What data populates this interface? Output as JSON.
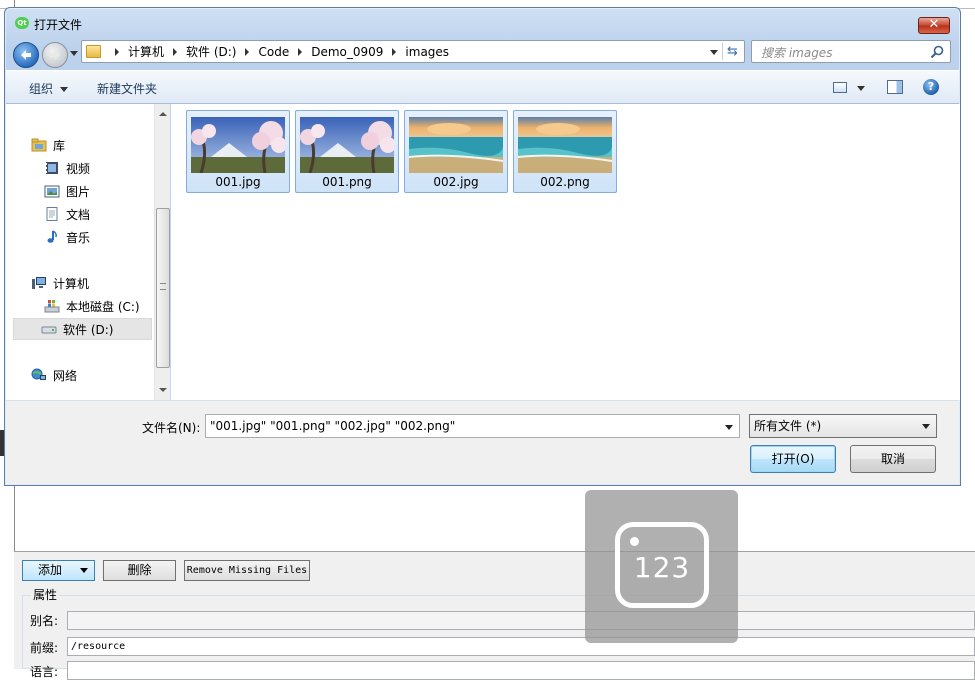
{
  "dialog": {
    "title": "打开文件",
    "app_icon_text": "Qt",
    "close_glyph": "✕"
  },
  "address": {
    "crumbs": [
      "计算机",
      "软件 (D:)",
      "Code",
      "Demo_0909",
      "images"
    ]
  },
  "search": {
    "placeholder": "搜索 images"
  },
  "toolbar": {
    "organize_label": "组织",
    "new_folder_label": "新建文件夹",
    "help_glyph": "?"
  },
  "nav": {
    "libraries": {
      "label": "库",
      "items": [
        "视频",
        "图片",
        "文档",
        "音乐"
      ]
    },
    "computer": {
      "label": "计算机",
      "items": [
        "本地磁盘 (C:)",
        "软件 (D:)"
      ]
    },
    "network": {
      "label": "网络"
    },
    "selected": "软件 (D:)"
  },
  "files": [
    {
      "name": "001.jpg",
      "thumb": "cherry-blossom"
    },
    {
      "name": "001.png",
      "thumb": "cherry-blossom"
    },
    {
      "name": "002.jpg",
      "thumb": "beach-sunset"
    },
    {
      "name": "002.png",
      "thumb": "beach-sunset"
    }
  ],
  "bottom": {
    "filename_label": "文件名(N):",
    "filename_value": "\"001.jpg\" \"001.png\" \"002.jpg\" \"002.png\"",
    "filetype_value": "所有文件 (*)",
    "open_label": "打开(O)",
    "cancel_label": "取消"
  },
  "background_app": {
    "add_label": "添加",
    "delete_label": "删除",
    "remove_missing_label": "Remove Missing Files",
    "properties_title": "属性",
    "alias_label": "别名:",
    "prefix_label": "前缀:",
    "prefix_value": "/resource",
    "lang_label": "语言:"
  },
  "watermark": {
    "text": "123"
  },
  "colors": {
    "selection_bg": "#cfe3f8",
    "selection_border": "#84acdd",
    "accent": "#3c7fb1",
    "close_red": "#c4462e"
  }
}
